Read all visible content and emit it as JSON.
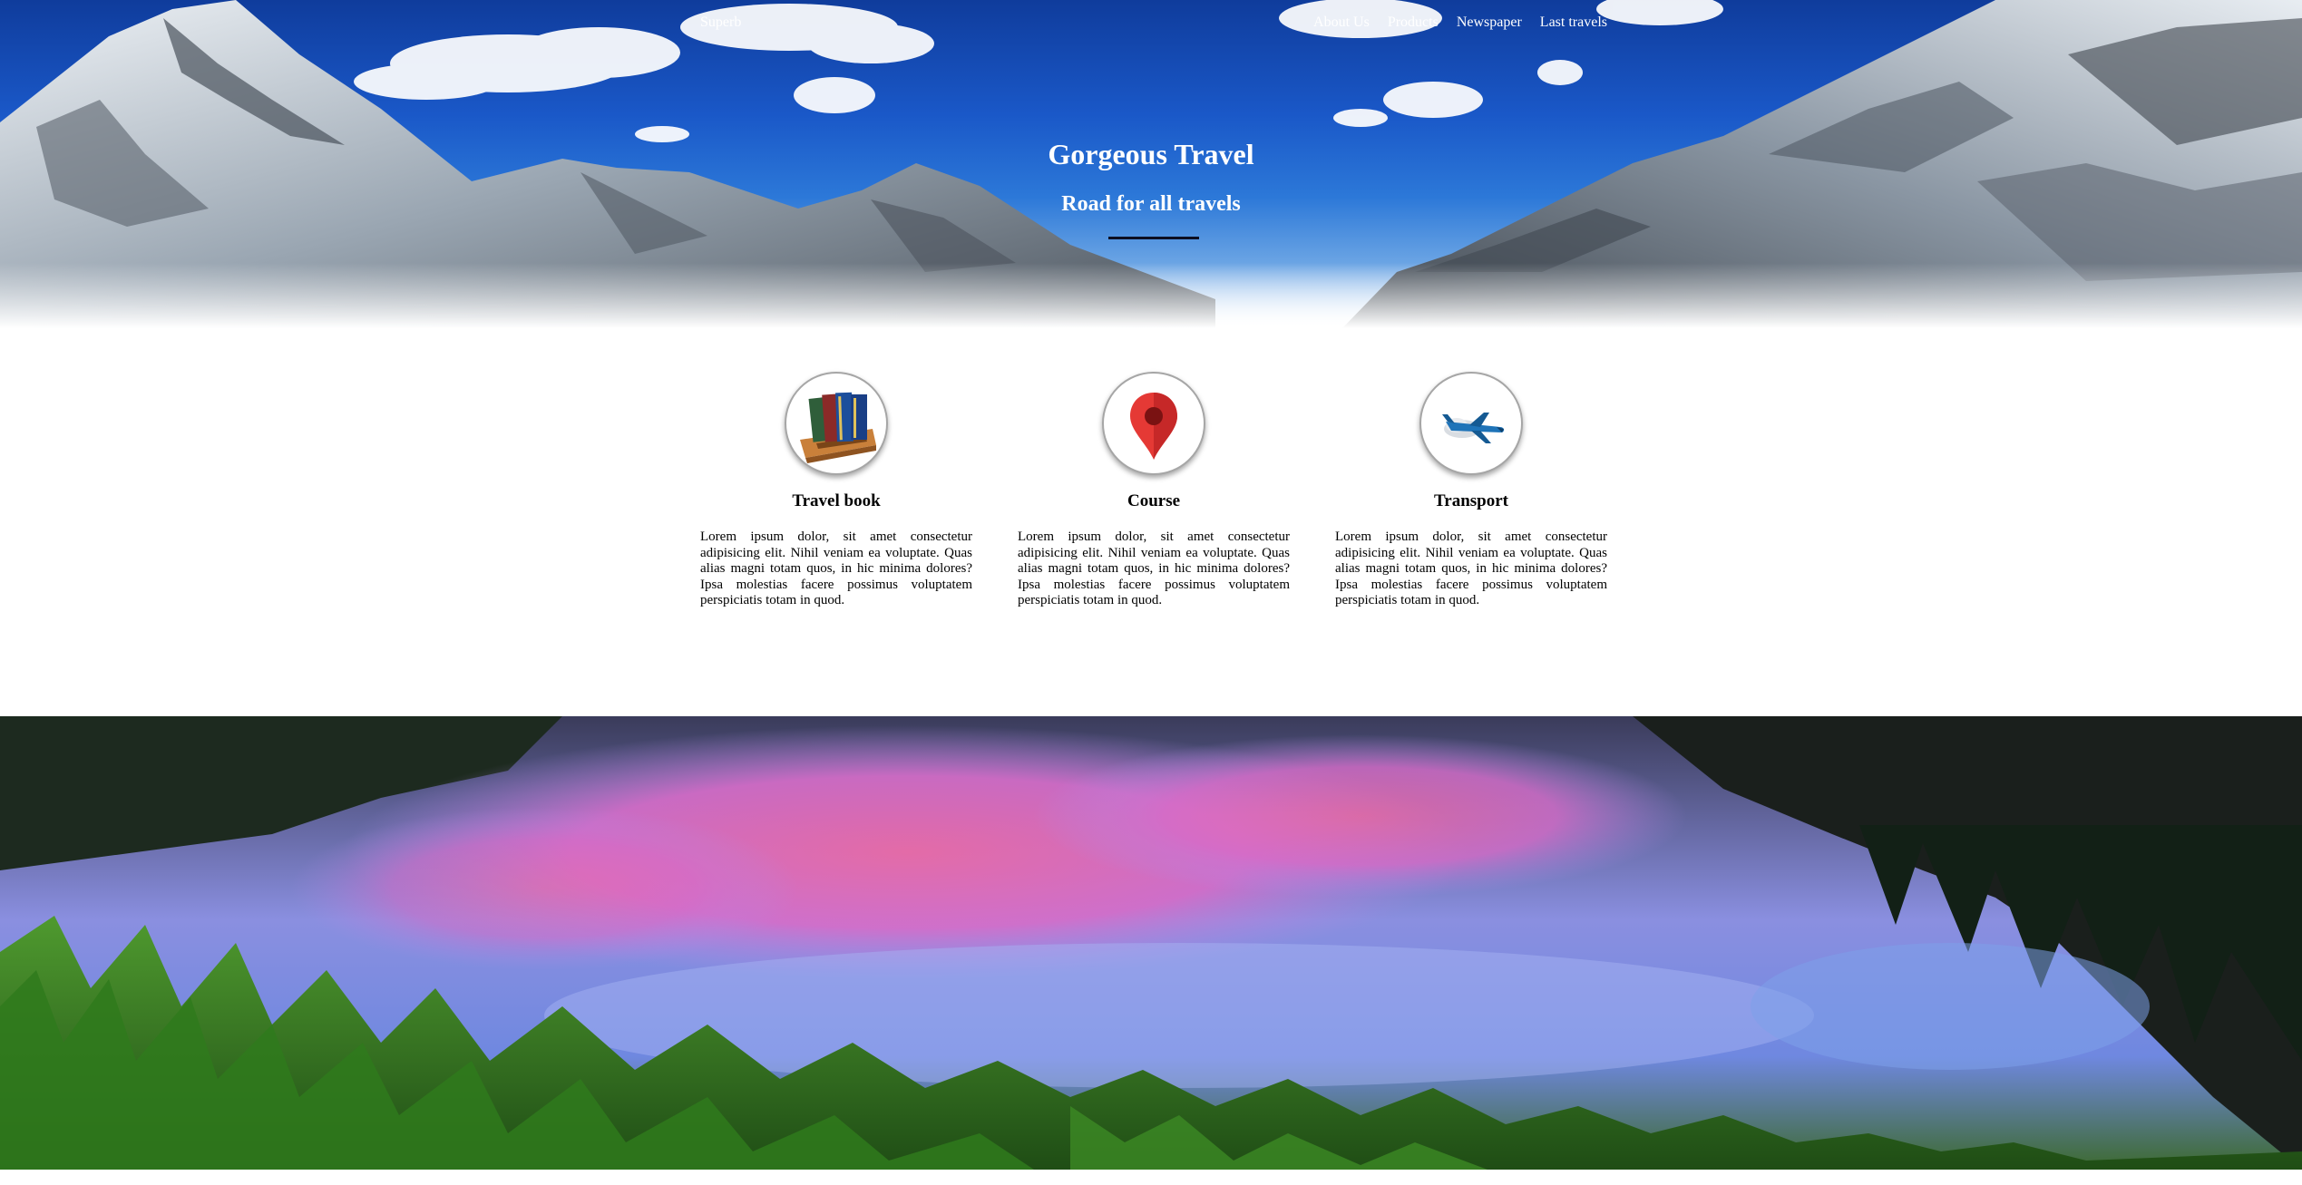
{
  "nav": {
    "brand": "Superb",
    "links": [
      "About Us",
      "Products",
      "Newspaper",
      "Last travels"
    ]
  },
  "hero": {
    "title": "Gorgeous Travel",
    "subtitle": "Road for all travels"
  },
  "features": [
    {
      "title": "Travel book",
      "icon": "books-icon",
      "text": "Lorem ipsum dolor, sit amet consectetur adipisicing elit. Nihil veniam ea voluptate. Quas alias magni totam quos, in hic minima dolores? Ipsa molestias facere possimus voluptatem perspiciatis totam in quod."
    },
    {
      "title": "Course",
      "icon": "map-pin-icon",
      "text": "Lorem ipsum dolor, sit amet consectetur adipisicing elit. Nihil veniam ea voluptate. Quas alias magni totam quos, in hic minima dolores? Ipsa molestias facere possimus voluptatem perspiciatis totam in quod."
    },
    {
      "title": "Transport",
      "icon": "airplane-icon",
      "text": "Lorem ipsum dolor, sit amet consectetur adipisicing elit. Nihil veniam ea voluptate. Quas alias magni totam quos, in hic minima dolores? Ipsa molestias facere possimus voluptatem perspiciatis totam in quod."
    }
  ],
  "colors": {
    "sky": "#1a58c8",
    "text": "#000000",
    "accent_rule": "#0d0f22",
    "pin_red": "#e53935",
    "plane_blue": "#1e73b8"
  }
}
